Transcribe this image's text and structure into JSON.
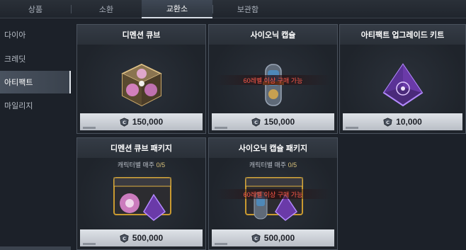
{
  "tabs": [
    {
      "label": "상품"
    },
    {
      "label": "소환"
    },
    {
      "label": "교환소",
      "active": true
    },
    {
      "label": "보관함"
    }
  ],
  "sidebar": {
    "items": [
      {
        "label": "다이아"
      },
      {
        "label": "크레딧"
      },
      {
        "label": "아티팩트",
        "active": true
      },
      {
        "label": "마일리지"
      }
    ]
  },
  "products": [
    {
      "name": "디멘션 큐브",
      "price": "150,000",
      "icon": "dimension-cube-icon"
    },
    {
      "name": "사이오닉 캡슐",
      "price": "150,000",
      "warning": "60레벨 이상 구매 가능",
      "icon": "psionic-capsule-icon"
    },
    {
      "name": "아티팩트 업그레이드 키트",
      "price": "10,000",
      "icon": "upgrade-kit-icon"
    },
    {
      "name": "디멘션 큐브 패키지",
      "price": "500,000",
      "limit_label": "캐릭터별 매주",
      "limit_count": "0/5",
      "icon": "dimension-cube-package-icon"
    },
    {
      "name": "사이오닉 캡슐 패키지",
      "price": "500,000",
      "limit_label": "캐릭터별 매주",
      "limit_count": "0/5",
      "warning": "60레벨 이상 구매 가능",
      "icon": "psionic-capsule-package-icon"
    }
  ],
  "currency_icon": "credit-coin-icon",
  "colors": {
    "warning": "#ff5a4a",
    "limit_count": "#d9c27a",
    "price_box": "#d4d8de"
  }
}
